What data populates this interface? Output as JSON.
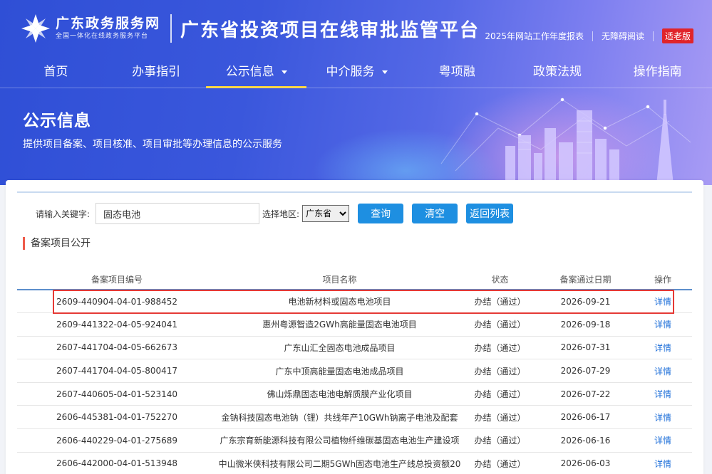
{
  "header": {
    "logo_name": "广东政务服务网",
    "logo_slogan": "全国一体化在线政务服务平台",
    "platform_title": "广东省投资项目在线审批监管平台",
    "links": [
      "2025年网站工作年度报表",
      "无障碍阅读"
    ],
    "elder_badge": "适老版"
  },
  "nav": {
    "items": [
      {
        "label": "首页",
        "dropdown": false,
        "active": false
      },
      {
        "label": "办事指引",
        "dropdown": false,
        "active": false
      },
      {
        "label": "公示信息",
        "dropdown": true,
        "active": true
      },
      {
        "label": "中介服务",
        "dropdown": true,
        "active": false
      },
      {
        "label": "粤项融",
        "dropdown": false,
        "active": false
      },
      {
        "label": "政策法规",
        "dropdown": false,
        "active": false
      },
      {
        "label": "操作指南",
        "dropdown": false,
        "active": false
      }
    ]
  },
  "banner": {
    "title": "公示信息",
    "subtitle": "提供项目备案、项目核准、项目审批等办理信息的公示服务"
  },
  "search": {
    "keyword_label": "请输入关键字:",
    "keyword_value": "固态电池",
    "region_label": "选择地区:",
    "region_value": "广东省",
    "query_button": "查询",
    "clear_button": "清空",
    "back_button": "返回列表"
  },
  "section": {
    "title": "备案项目公开"
  },
  "table": {
    "headers": [
      "备案项目编号",
      "项目名称",
      "状态",
      "备案通过日期",
      "操作"
    ],
    "rows": [
      {
        "code": "2609-440904-04-01-988452",
        "name": "电池新材料或固态电池项目",
        "status": "办结（通过）",
        "date": "2026-09-21",
        "op": "详情"
      },
      {
        "code": "2609-441322-04-05-924041",
        "name": "惠州粤源智造2GWh高能量固态电池项目",
        "status": "办结（通过）",
        "date": "2026-09-18",
        "op": "详情"
      },
      {
        "code": "2607-441704-04-05-662673",
        "name": "广东山汇全固态电池成品项目",
        "status": "办结（通过）",
        "date": "2026-07-31",
        "op": "详情"
      },
      {
        "code": "2607-441704-04-05-800417",
        "name": "广东中顶高能量固态电池成品项目",
        "status": "办结（通过）",
        "date": "2026-07-29",
        "op": "详情"
      },
      {
        "code": "2607-440605-04-01-523140",
        "name": "佛山烁鼎固态电池电解质膜产业化项目",
        "status": "办结（通过）",
        "date": "2026-07-22",
        "op": "详情"
      },
      {
        "code": "2606-445381-04-01-752270",
        "name": "金钠科技固态电池钠（锂）共线年产10GWh钠离子电池及配套",
        "status": "办结（通过）",
        "date": "2026-06-17",
        "op": "详情"
      },
      {
        "code": "2606-440229-04-01-275689",
        "name": "广东宗育新能源科技有限公司植物纤维碳基固态电池生产建设项",
        "status": "办结（通过）",
        "date": "2026-06-16",
        "op": "详情"
      },
      {
        "code": "2606-442000-04-01-513948",
        "name": "中山微米侠科技有限公司二期5GWh固态电池生产线总投资额20",
        "status": "办结（通过）",
        "date": "2026-06-03",
        "op": "详情"
      }
    ]
  },
  "colors": {
    "accent_blue": "#1e8fe1",
    "highlight_red": "#e53935",
    "nav_active": "#ffd33a"
  }
}
